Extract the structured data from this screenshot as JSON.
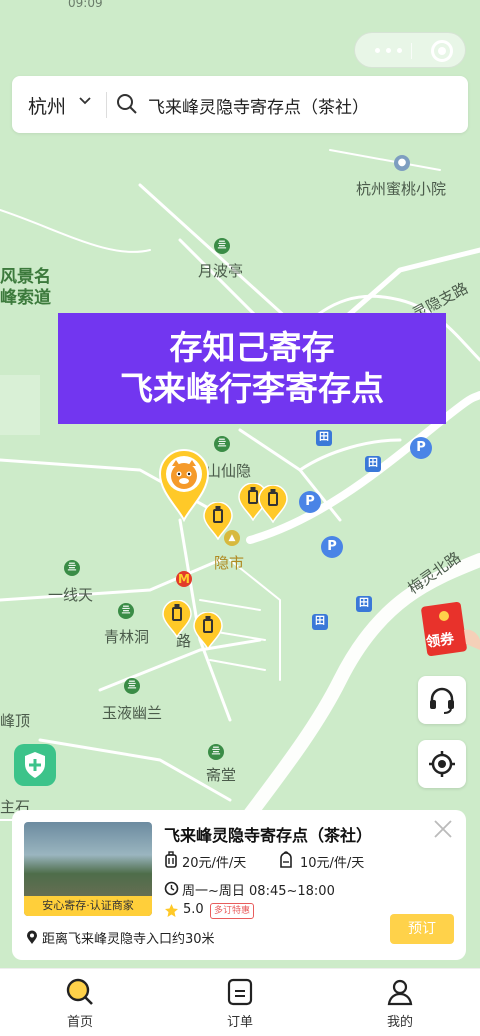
{
  "status_bar": {
    "time": "09:09"
  },
  "search": {
    "city": "杭州",
    "query": "飞来峰灵隐寺寄存点（茶社）"
  },
  "map_labels": {
    "school": "杭州蜜桃小院",
    "yuebo": "月波亭",
    "lingyin_road": "灵隐支路",
    "scenic_1": "风景名",
    "scenic_2": "峰索道",
    "shanxianyin": "山仙隐",
    "yinshi": "隐市",
    "yixiantian": "一线天",
    "qinglindong": "青林洞",
    "yuyeyoulan": "玉液幽兰",
    "meiling_road": "梅灵北路",
    "fengding": "峰顶",
    "zhaitang": "斋堂",
    "zhushi": "主石",
    "road_fragment": "路"
  },
  "banner": {
    "line1": "存知己寄存",
    "line2": "飞来峰行李寄存点"
  },
  "store": {
    "image_badge": "安心寄存·认证商家",
    "name": "飞来峰灵隐寺寄存点（茶社）",
    "price_large": "20元/件/天",
    "price_small": "10元/件/天",
    "hours": "周一~周日 08:45~18:00",
    "rating": "5.0",
    "tag": "多订特惠",
    "distance": "距离飞来峰灵隐寺入口约30米",
    "book_label": "预订"
  },
  "coupon": {
    "label": "领券"
  },
  "tabs": [
    {
      "label": "首页",
      "icon": "search-icon",
      "active": true
    },
    {
      "label": "订单",
      "icon": "order-icon",
      "active": false
    },
    {
      "label": "我的",
      "icon": "profile-icon",
      "active": false
    }
  ],
  "colors": {
    "accent": "#ffd24a",
    "banner": "#7236f0",
    "map_bg": "#cdebc9"
  }
}
